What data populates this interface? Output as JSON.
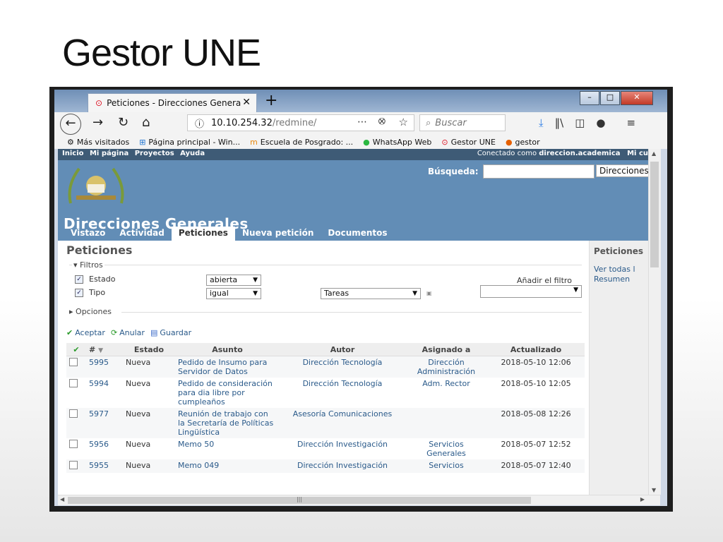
{
  "slide": {
    "title": "Gestor UNE"
  },
  "browser": {
    "tab_title": "Peticiones - Direcciones Genera",
    "url_host": "10.10.254.32",
    "url_path": "/redmine/",
    "search_placeholder": "Buscar",
    "bookmarks": [
      {
        "icon": "gear-icon",
        "label": "Más visitados"
      },
      {
        "icon": "windows-icon",
        "label": "Página principal - Win..."
      },
      {
        "icon": "moodle-icon",
        "label": "Escuela de Posgrado: ..."
      },
      {
        "icon": "whatsapp-icon",
        "label": "WhatsApp Web"
      },
      {
        "icon": "redmine-icon",
        "label": "Gestor UNE"
      },
      {
        "icon": "firefox-icon",
        "label": "gestor"
      }
    ]
  },
  "redmine": {
    "top_menu": [
      "Inicio",
      "Mi página",
      "Proyectos",
      "Ayuda"
    ],
    "logged_as_prefix": "Conectado como",
    "logged_as_user": "direccion.academica",
    "logged_as_suffix": "Mi cu",
    "search_label": "Búsqueda:",
    "project_select": "Direcciones",
    "project_title": "Direcciones Generales",
    "tabs": [
      {
        "label": "Vistazo",
        "active": false
      },
      {
        "label": "Actividad",
        "active": false
      },
      {
        "label": "Peticiones",
        "active": true
      },
      {
        "label": "Nueva petición",
        "active": false
      },
      {
        "label": "Documentos",
        "active": false
      }
    ],
    "heading": "Peticiones",
    "filters_legend": "Filtros",
    "filters": [
      {
        "label": "Estado",
        "operator": "abierta",
        "value": ""
      },
      {
        "label": "Tipo",
        "operator": "igual",
        "value": "Tareas"
      }
    ],
    "add_filter_label": "Añadir el filtro",
    "options_legend": "Opciones",
    "actions": [
      "Aceptar",
      "Anular",
      "Guardar"
    ],
    "columns": [
      "#",
      "Estado",
      "Asunto",
      "Autor",
      "Asignado a",
      "Actualizado"
    ],
    "issues": [
      {
        "id": "5995",
        "status": "Nueva",
        "subject": "Pedido de Insumo para Servidor de Datos",
        "author": "Dirección Tecnología",
        "assigned": "Dirección Administración",
        "updated": "2018-05-10 12:06"
      },
      {
        "id": "5994",
        "status": "Nueva",
        "subject": "Pedido de consideración para dia libre por cumpleaños",
        "author": "Dirección Tecnología",
        "assigned": "Adm. Rector",
        "updated": "2018-05-10 12:05"
      },
      {
        "id": "5977",
        "status": "Nueva",
        "subject": "Reunión de trabajo con la Secretaría de Políticas Lingüística",
        "author": "Asesoría Comunicaciones",
        "assigned": "",
        "updated": "2018-05-08 12:26"
      },
      {
        "id": "5956",
        "status": "Nueva",
        "subject": "Memo 50",
        "author": "Dirección Investigación",
        "assigned": "Servicios Generales",
        "updated": "2018-05-07 12:52"
      },
      {
        "id": "5955",
        "status": "Nueva",
        "subject": "Memo 049",
        "author": "Dirección Investigación",
        "assigned": "Servicios",
        "updated": "2018-05-07 12:40"
      }
    ],
    "sidebar": {
      "title": "Peticiones",
      "links": [
        "Ver todas l",
        "Resumen"
      ]
    }
  },
  "colors": {
    "header": "#628db6",
    "topmenu": "#3e5b76",
    "link": "#2a5a8a"
  }
}
